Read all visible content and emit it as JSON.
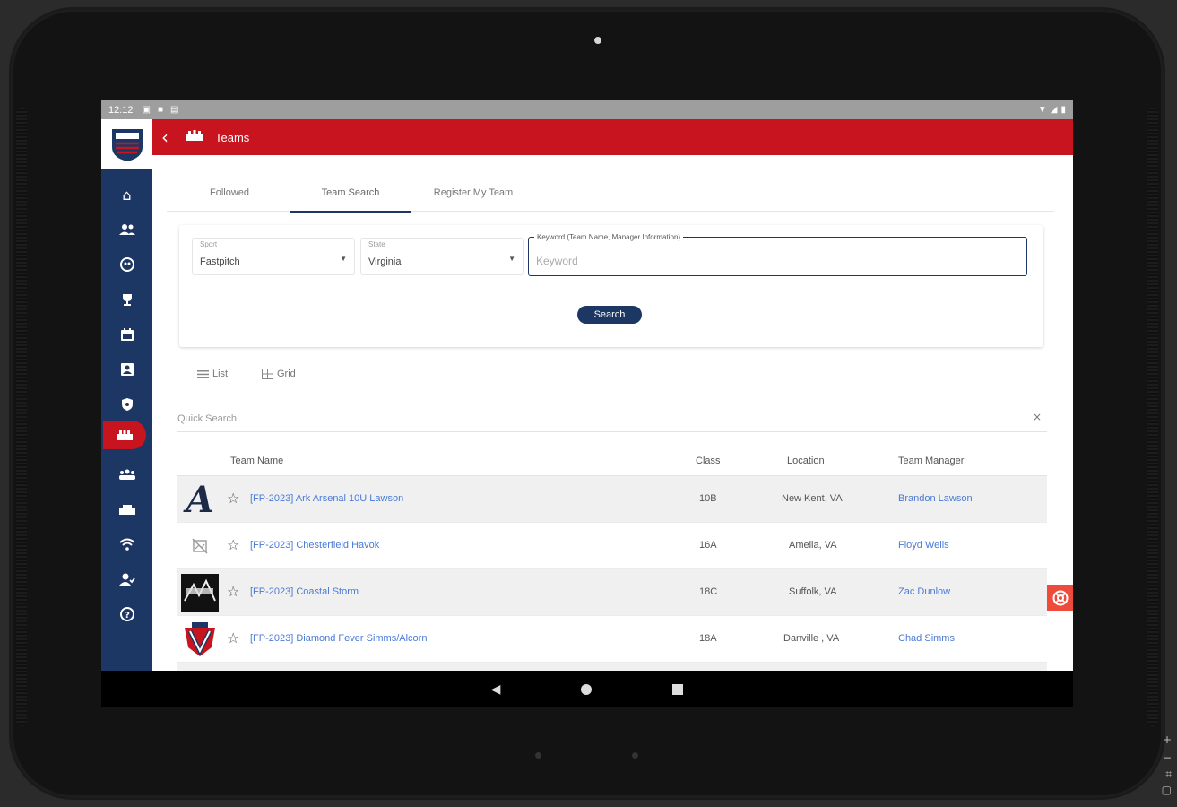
{
  "status_bar": {
    "time": "12:12"
  },
  "app_bar": {
    "title": "Teams"
  },
  "sidebar": {
    "items": [
      {
        "icon": "home-icon"
      },
      {
        "icon": "users-icon"
      },
      {
        "icon": "softball-icon"
      },
      {
        "icon": "trophy-icon"
      },
      {
        "icon": "calendar-icon"
      },
      {
        "icon": "contact-card-icon"
      },
      {
        "icon": "shield-icon"
      },
      {
        "icon": "team-icon",
        "active": true
      },
      {
        "icon": "group-icon"
      },
      {
        "icon": "stadium-icon"
      },
      {
        "icon": "wifi-icon"
      },
      {
        "icon": "user-check-icon"
      },
      {
        "icon": "help-icon"
      }
    ]
  },
  "tabs": [
    {
      "label": "Followed"
    },
    {
      "label": "Team Search",
      "active": true
    },
    {
      "label": "Register My Team"
    }
  ],
  "search": {
    "sport_label": "Sport",
    "sport_value": "Fastpitch",
    "state_label": "State",
    "state_value": "Virginia",
    "keyword_label": "Keyword (Team Name, Manager Information)",
    "keyword_placeholder": "Keyword",
    "button": "Search"
  },
  "view": {
    "list": "List",
    "grid": "Grid"
  },
  "quick_search": {
    "placeholder": "Quick Search",
    "clear": "×"
  },
  "table": {
    "headers": {
      "team_name": "Team Name",
      "class": "Class",
      "location": "Location",
      "manager": "Team Manager"
    },
    "rows": [
      {
        "team": "[FP-2023] Ark Arsenal 10U Lawson",
        "class": "10B",
        "location": "New Kent, VA",
        "manager": "Brandon Lawson"
      },
      {
        "team": "[FP-2023] Chesterfield Havok",
        "class": "16A",
        "location": "Amelia, VA",
        "manager": "Floyd Wells"
      },
      {
        "team": "[FP-2023] Coastal Storm",
        "class": "18C",
        "location": "Suffolk, VA",
        "manager": "Zac Dunlow"
      },
      {
        "team": "[FP-2023] Diamond Fever Simms/Alcorn",
        "class": "18A",
        "location": "Danville , VA",
        "manager": "Chad Simms"
      }
    ]
  },
  "colors": {
    "brand_red": "#c8141f",
    "navy": "#1d3764",
    "link": "#4a7ad6"
  }
}
